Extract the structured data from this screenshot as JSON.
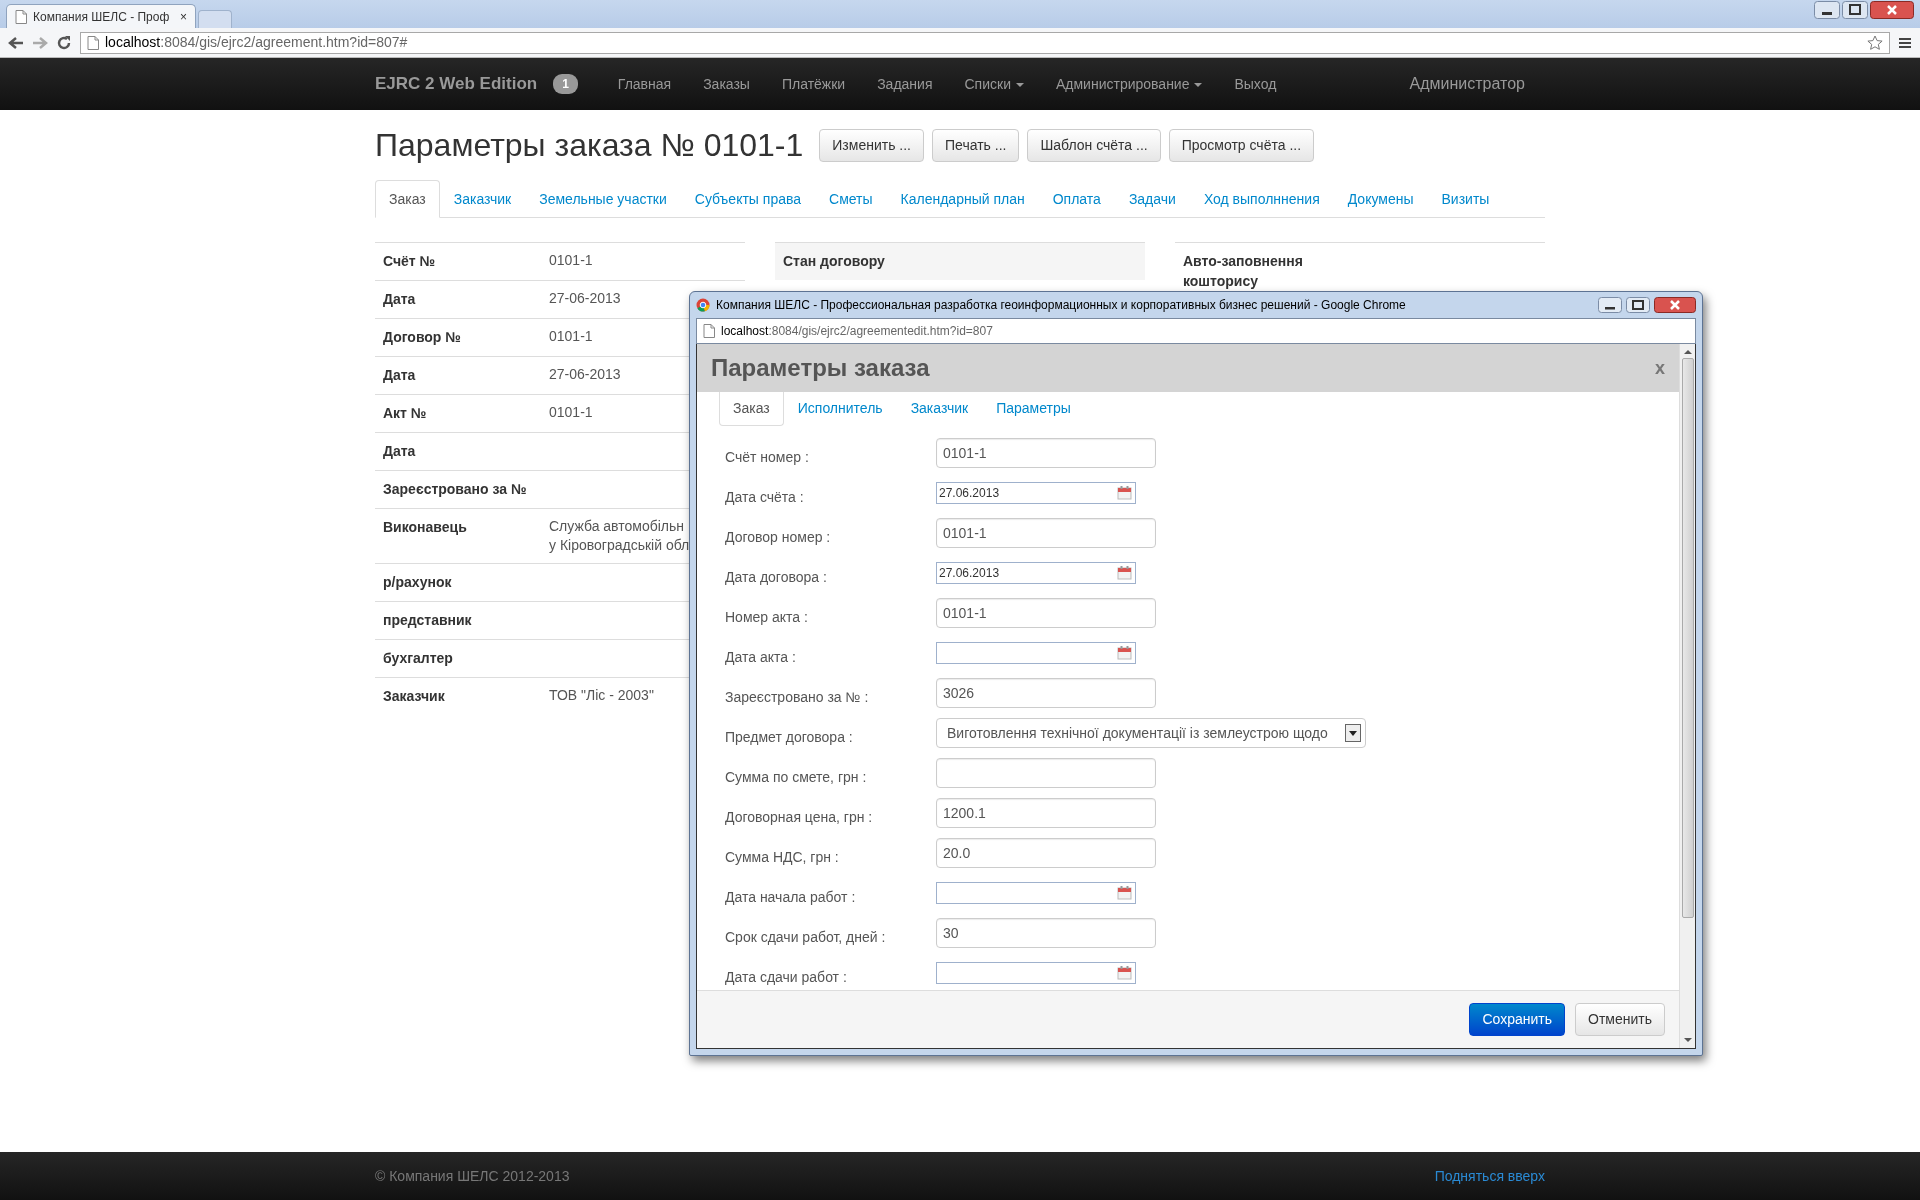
{
  "browser": {
    "tab_title": "Компания ШЕЛС - Проф",
    "tab_close": "×",
    "url_host": "localhost",
    "url_rest": ":8084/gis/ejrc2/agreement.htm?id=807#"
  },
  "navbar": {
    "brand": "EJRC 2 Web Edition",
    "badge": "1",
    "items": [
      {
        "label": "Главная",
        "dropdown": false
      },
      {
        "label": "Заказы",
        "dropdown": false
      },
      {
        "label": "Платёжки",
        "dropdown": false
      },
      {
        "label": "Задания",
        "dropdown": false
      },
      {
        "label": "Списки",
        "dropdown": true
      },
      {
        "label": "Администрирование",
        "dropdown": true
      },
      {
        "label": "Выход",
        "dropdown": false
      }
    ],
    "user": "Администратор"
  },
  "page": {
    "title": "Параметры заказа № 0101-1",
    "buttons": [
      "Изменить ...",
      "Печать ...",
      "Шаблон счёта ...",
      "Просмотр счёта ..."
    ],
    "tabs": [
      {
        "label": "Заказ",
        "selected": true
      },
      {
        "label": "Заказчик",
        "selected": false
      },
      {
        "label": "Земельные участки",
        "selected": false
      },
      {
        "label": "Субъекты права",
        "selected": false
      },
      {
        "label": "Сметы",
        "selected": false
      },
      {
        "label": "Календарный план",
        "selected": false
      },
      {
        "label": "Оплата",
        "selected": false
      },
      {
        "label": "Задачи",
        "selected": false
      },
      {
        "label": "Ход выполннения",
        "selected": false
      },
      {
        "label": "Докумены",
        "selected": false
      },
      {
        "label": "Визиты",
        "selected": false
      }
    ],
    "details": [
      {
        "label": "Счёт №",
        "lines": [
          "0101-1"
        ]
      },
      {
        "label": "Дата",
        "lines": [
          "27-06-2013"
        ]
      },
      {
        "label": "Договор №",
        "lines": [
          "0101-1"
        ]
      },
      {
        "label": "Дата",
        "lines": [
          "27-06-2013"
        ]
      },
      {
        "label": "Акт №",
        "lines": [
          "0101-1"
        ]
      },
      {
        "label": "Дата"
      },
      {
        "label": "Зареєстровано за №"
      },
      {
        "label": "Виконавець",
        "lines": [
          "Служба автомобільн",
          "у Кіровоградській обл"
        ]
      },
      {
        "label": "р/рахунок"
      },
      {
        "label": "представник"
      },
      {
        "label": "бухгалтер"
      },
      {
        "label": "Заказчик",
        "lines": [
          "ТОВ \"Ліс - 2003\""
        ]
      }
    ],
    "status_header": "Стан договору",
    "autofill_label": "Авто-заповнення кошторису"
  },
  "popup": {
    "window_title": "Компания ШЕЛС - Профессиональная разработка геоинформационных и корпоративных бизнес решений - Google Chrome",
    "url_host": "localhost",
    "url_rest": ":8084/gis/ejrc2/agreementedit.htm?id=807",
    "modal_title": "Параметры заказа",
    "close": "x",
    "tabs": [
      {
        "label": "Заказ",
        "selected": true
      },
      {
        "label": "Исполнитель",
        "selected": false
      },
      {
        "label": "Заказчик",
        "selected": false
      },
      {
        "label": "Параметры",
        "selected": false
      }
    ],
    "fields": [
      {
        "kind": "text",
        "label": "Счёт номер :",
        "value": "0101-1"
      },
      {
        "kind": "date",
        "label": "Дата счёта :",
        "value": "27.06.2013"
      },
      {
        "kind": "text",
        "label": "Договор номер :",
        "value": "0101-1"
      },
      {
        "kind": "date",
        "label": "Дата договора :",
        "value": "27.06.2013"
      },
      {
        "kind": "text",
        "label": "Номер акта :",
        "value": "0101-1"
      },
      {
        "kind": "date",
        "label": "Дата акта :"
      },
      {
        "kind": "text",
        "label": "Зареєстровано за № :",
        "value": "3026"
      },
      {
        "kind": "select",
        "label": "Предмет договора :",
        "value": "Виготовлення технічної документації із землеустрою щодо"
      },
      {
        "kind": "text",
        "label": "Сумма по смете, грн :"
      },
      {
        "kind": "text",
        "label": "Договорная цена, грн :",
        "value": "1200.1"
      },
      {
        "kind": "text",
        "label": "Сумма НДС, грн :",
        "value": "20.0"
      },
      {
        "kind": "date",
        "label": "Дата начала работ :"
      },
      {
        "kind": "text",
        "label": "Срок сдачи работ, дней :",
        "value": "30"
      },
      {
        "kind": "date",
        "label": "Дата сдачи работ :"
      }
    ],
    "buttons": [
      {
        "label": "Сохранить",
        "kind": "primary"
      },
      {
        "label": "Отменить",
        "kind": "default"
      }
    ]
  },
  "footer": {
    "copyright": "© Компания ШЕЛС 2012-2013",
    "link": "Подняться вверх"
  }
}
